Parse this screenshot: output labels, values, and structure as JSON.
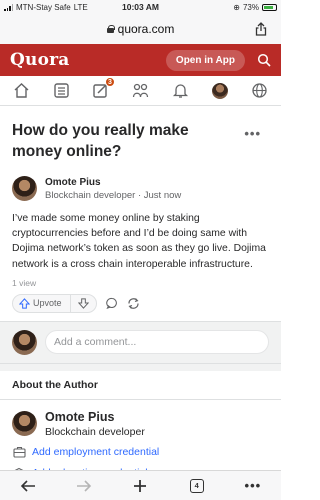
{
  "status_bar": {
    "carrier": "MTN-Stay Safe",
    "network": "LTE",
    "time": "10:03 AM",
    "battery": "73%",
    "battery_level": 0.73
  },
  "browser": {
    "url": "quora.com",
    "tab_count": "4"
  },
  "header": {
    "logo": "Quora",
    "open_app_label": "Open in App",
    "brand_color": "#b92b27"
  },
  "nav": {
    "items": [
      {
        "icon": "home-icon"
      },
      {
        "icon": "following-icon"
      },
      {
        "icon": "answer-icon",
        "badge": "3"
      },
      {
        "icon": "spaces-icon"
      },
      {
        "icon": "notifications-icon"
      },
      {
        "icon": "avatar"
      },
      {
        "icon": "globe-icon"
      }
    ]
  },
  "question": {
    "title": "How do you really make money online?",
    "more": "..."
  },
  "answer": {
    "author_name": "Omote Pius",
    "author_credential": "Blockchain developer",
    "separator": " · ",
    "time": "Just now",
    "text": "I’ve made some money online by staking cryptocurrencies before and I’d be doing same with Dojima network’s token as soon as they go live. Dojima network is a cross chain interoperable infrastructure.",
    "views": "1 view",
    "upvote_label": "Upvote"
  },
  "comment": {
    "placeholder": "Add a comment..."
  },
  "about": {
    "heading": "About the Author",
    "name": "Omote Pius",
    "credential": "Blockchain developer",
    "add_employment": "Add employment credential",
    "add_education": "Add education credential",
    "link_color": "#2e69ff"
  }
}
